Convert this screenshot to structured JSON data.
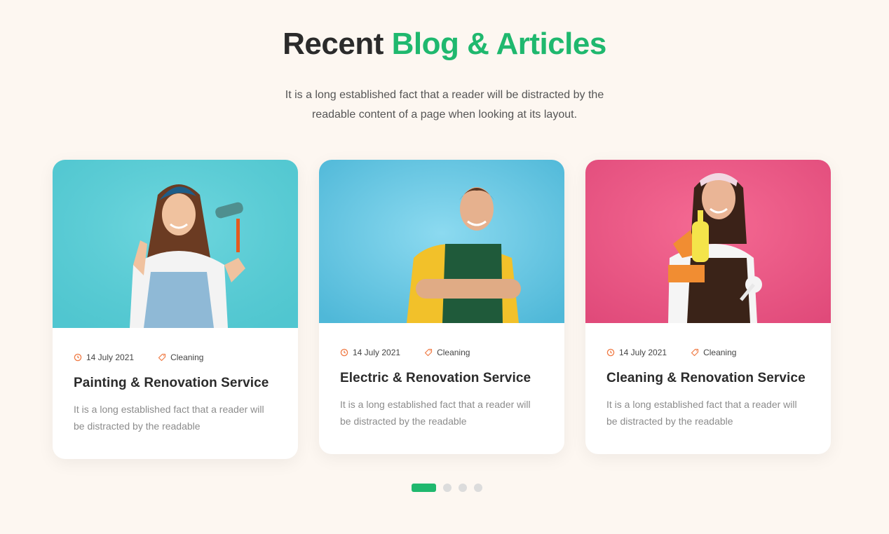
{
  "section": {
    "title_part1": "Recent",
    "title_part2": "Blog & Articles",
    "subtitle": "It is a long established fact that a reader will be distracted by the readable content of a page when looking at its layout."
  },
  "colors": {
    "accent": "#1fb86e",
    "meta_icon": "#f07b45",
    "background": "#fdf7f1"
  },
  "cards": [
    {
      "date": "14 July 2021",
      "category": "Cleaning",
      "title": "Painting & Renovation Service",
      "excerpt": "It is a long established fact that a reader will be distracted by the readable",
      "image_desc": "woman-with-paint-roller"
    },
    {
      "date": "14 July 2021",
      "category": "Cleaning",
      "title": "Electric & Renovation Service",
      "excerpt": "It is a long established fact that a reader will be distracted by the readable",
      "image_desc": "man-with-tools"
    },
    {
      "date": "14 July 2021",
      "category": "Cleaning",
      "title": "Cleaning & Renovation Service",
      "excerpt": "It is a long established fact that a reader will be distracted by the readable",
      "image_desc": "woman-with-cleaning-spray"
    }
  ],
  "pagination": {
    "total": 4,
    "active": 1
  }
}
